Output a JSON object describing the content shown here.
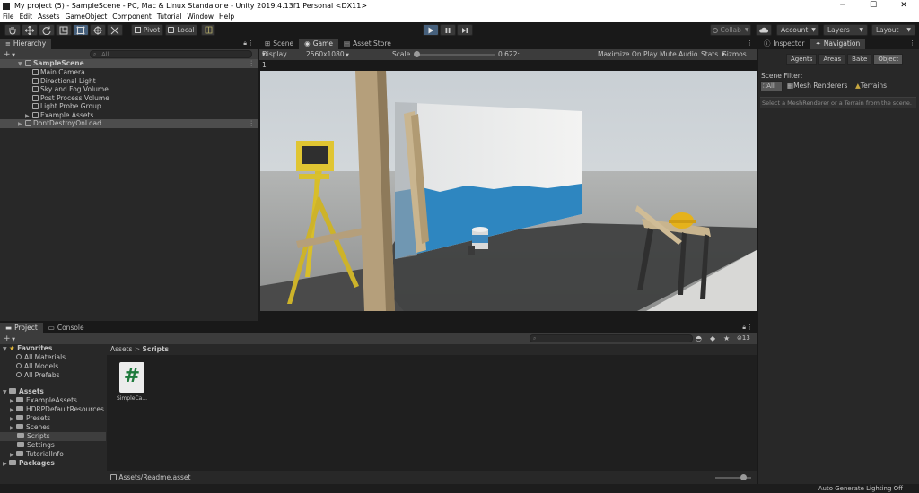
{
  "window": {
    "title": "My project (5) - SampleScene - PC, Mac & Linux Standalone - Unity 2019.4.13f1 Personal <DX11>",
    "minimize": "─",
    "maximize": "☐",
    "close": "✕"
  },
  "menu": [
    "File",
    "Edit",
    "Assets",
    "GameObject",
    "Component",
    "Tutorial",
    "Window",
    "Help"
  ],
  "toolbar": {
    "pivot_label": "Pivot",
    "local_label": "Local",
    "collab_label": "Collab",
    "account_label": "Account",
    "layers_label": "Layers",
    "layout_label": "Layout",
    "play_state": "playing"
  },
  "hierarchy": {
    "tab_label": "Hierarchy",
    "add_label": "+",
    "search_placeholder": "All",
    "items": [
      {
        "label": "SampleScene",
        "depth": 0,
        "expanded": true,
        "selected": true,
        "bold": true
      },
      {
        "label": "Main Camera",
        "depth": 1
      },
      {
        "label": "Directional Light",
        "depth": 1
      },
      {
        "label": "Sky and Fog Volume",
        "depth": 1
      },
      {
        "label": "Post Process Volume",
        "depth": 1
      },
      {
        "label": "Light Probe Group",
        "depth": 1
      },
      {
        "label": "Example Assets",
        "depth": 1,
        "collapsed": true
      },
      {
        "label": "DontDestroyOnLoad",
        "depth": 0,
        "collapsed": true,
        "selected": true
      }
    ]
  },
  "center": {
    "tabs": [
      "Scene",
      "Game",
      "Asset Store"
    ],
    "active_tab": "Game",
    "display_label": "Display 1",
    "resolution_label": "2560x1080",
    "scale_label": "Scale",
    "scale_value": "0.622:",
    "scale_fraction": 0.02,
    "maximize_label": "Maximize On Play",
    "mute_label": "Mute Audio",
    "stats_label": "Stats",
    "gizmos_label": "Gizmos"
  },
  "inspector": {
    "tabs": [
      "Inspector",
      "Navigation"
    ],
    "active_tab": "Navigation",
    "nav_buttons": [
      "Agents",
      "Areas",
      "Bake",
      "Object"
    ],
    "active_nav": "Object",
    "scene_filter_label": "Scene Filter:",
    "filter_options": [
      "All",
      "Mesh Renderers",
      "Terrains"
    ],
    "hint": "Select a MeshRenderer or a Terrain from the scene."
  },
  "project": {
    "tabs": [
      "Project",
      "Console"
    ],
    "active_tab": "Project",
    "favorites_label": "Favorites",
    "favorites": [
      "All Materials",
      "All Models",
      "All Prefabs"
    ],
    "assets_label": "Assets",
    "asset_folders": [
      "ExampleAssets",
      "HDRPDefaultResources",
      "Presets",
      "Scenes",
      "Scripts",
      "Settings",
      "TutorialInfo"
    ],
    "selected_folder": "Scripts",
    "packages_label": "Packages",
    "breadcrumb_root": "Assets",
    "breadcrumb_current": "Scripts",
    "files": [
      {
        "name": "SimpleCa...",
        "glyph": "#"
      }
    ],
    "hidden_count": "13",
    "footer_path": "Assets/Readme.asset",
    "zoom_fraction": 0.78
  },
  "status": {
    "text": "Auto Generate Lighting Off"
  },
  "colors": {
    "accent_play": "#46607c",
    "panel": "#282828",
    "dark": "#191919",
    "script_icon_green": "#1e7a3c"
  }
}
